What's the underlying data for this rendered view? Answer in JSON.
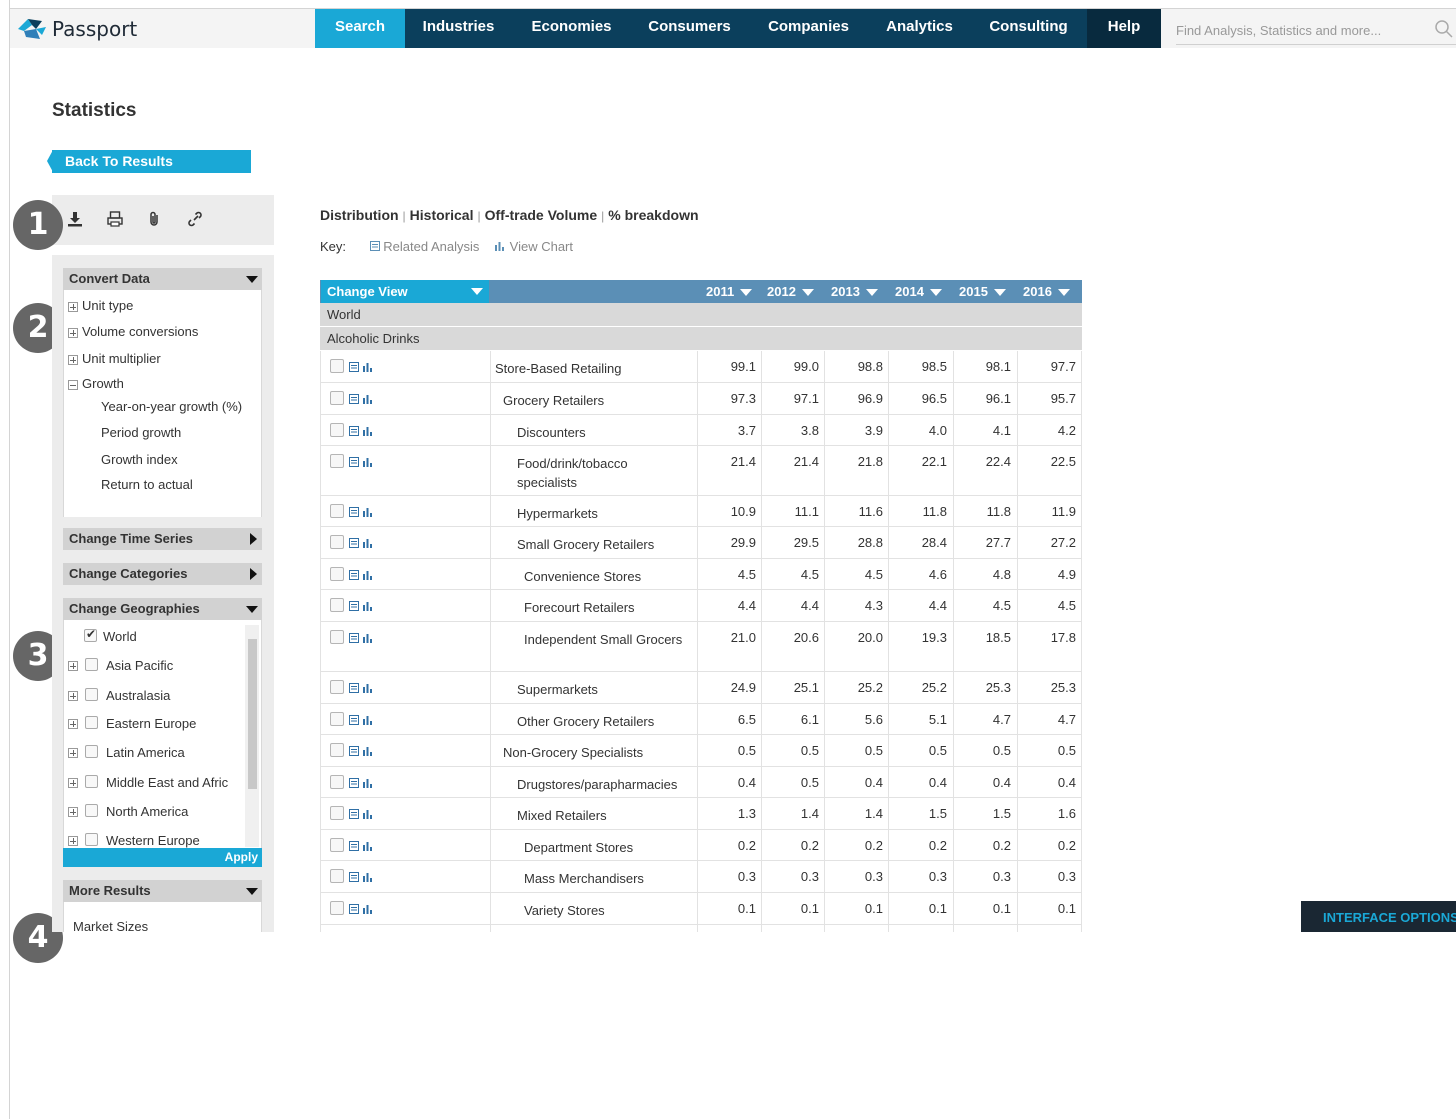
{
  "app": {
    "name": "Passport"
  },
  "nav": {
    "items": [
      {
        "label": "Search"
      },
      {
        "label": "Industries"
      },
      {
        "label": "Economies"
      },
      {
        "label": "Consumers"
      },
      {
        "label": "Companies"
      },
      {
        "label": "Analytics"
      },
      {
        "label": "Consulting"
      },
      {
        "label": "Help"
      }
    ],
    "active": "Search"
  },
  "search": {
    "placeholder": "Find Analysis, Statistics and more..."
  },
  "page": {
    "title": "Statistics",
    "back_label": "Back To Results"
  },
  "toolbar": {
    "icons": [
      "download-icon",
      "print-icon",
      "attach-icon",
      "link-icon"
    ]
  },
  "markers": [
    "1",
    "2",
    "3",
    "4"
  ],
  "sidebar": {
    "convert": {
      "title": "Convert Data",
      "items": [
        {
          "label": "Unit type"
        },
        {
          "label": "Volume conversions"
        },
        {
          "label": "Unit multiplier"
        },
        {
          "label": "Growth"
        }
      ],
      "growth_items": [
        {
          "label": "Year-on-year growth (%)"
        },
        {
          "label": "Period growth"
        },
        {
          "label": "Growth index"
        },
        {
          "label": "Return to actual"
        }
      ]
    },
    "time_series": {
      "title": "Change Time Series"
    },
    "categories": {
      "title": "Change Categories"
    },
    "geographies": {
      "title": "Change Geographies",
      "items": [
        {
          "label": "World",
          "checked": true
        },
        {
          "label": "Asia Pacific",
          "checked": false
        },
        {
          "label": "Australasia",
          "checked": false
        },
        {
          "label": "Eastern Europe",
          "checked": false
        },
        {
          "label": "Latin America",
          "checked": false
        },
        {
          "label": "Middle East and Afric",
          "checked": false
        },
        {
          "label": "North America",
          "checked": false
        },
        {
          "label": "Western Europe",
          "checked": false
        }
      ],
      "apply_label": "Apply"
    },
    "more": {
      "title": "More Results",
      "items": [
        {
          "label": "Market Sizes"
        }
      ]
    }
  },
  "breadcrumb": [
    "Distribution",
    "Historical",
    "Off-trade Volume",
    "% breakdown"
  ],
  "key": {
    "label": "Key:",
    "related": "Related Analysis",
    "chart": "View Chart"
  },
  "table": {
    "change_view": "Change View",
    "years": [
      "2011",
      "2012",
      "2013",
      "2014",
      "2015",
      "2016"
    ],
    "group_geo": "World",
    "group_cat": "Alcoholic Drinks",
    "rows": [
      {
        "label": "Store-Based Retailing",
        "values": [
          "99.1",
          "99.0",
          "98.8",
          "98.5",
          "98.1",
          "97.7"
        ]
      },
      {
        "label": "Grocery Retailers",
        "values": [
          "97.3",
          "97.1",
          "96.9",
          "96.5",
          "96.1",
          "95.7"
        ]
      },
      {
        "label": "Discounters",
        "values": [
          "3.7",
          "3.8",
          "3.9",
          "4.0",
          "4.1",
          "4.2"
        ]
      },
      {
        "label": "Food/drink/tobacco specialists",
        "values": [
          "21.4",
          "21.4",
          "21.8",
          "22.1",
          "22.4",
          "22.5"
        ]
      },
      {
        "label": "Hypermarkets",
        "values": [
          "10.9",
          "11.1",
          "11.6",
          "11.8",
          "11.8",
          "11.9"
        ]
      },
      {
        "label": "Small Grocery Retailers",
        "values": [
          "29.9",
          "29.5",
          "28.8",
          "28.4",
          "27.7",
          "27.2"
        ]
      },
      {
        "label": "Convenience Stores",
        "values": [
          "4.5",
          "4.5",
          "4.5",
          "4.6",
          "4.8",
          "4.9"
        ]
      },
      {
        "label": "Forecourt Retailers",
        "values": [
          "4.4",
          "4.4",
          "4.3",
          "4.4",
          "4.5",
          "4.5"
        ]
      },
      {
        "label": "Independent Small Grocers",
        "values": [
          "21.0",
          "20.6",
          "20.0",
          "19.3",
          "18.5",
          "17.8"
        ]
      },
      {
        "label": "Supermarkets",
        "values": [
          "24.9",
          "25.1",
          "25.2",
          "25.2",
          "25.3",
          "25.3"
        ]
      },
      {
        "label": "Other Grocery Retailers",
        "values": [
          "6.5",
          "6.1",
          "5.6",
          "5.1",
          "4.7",
          "4.7"
        ]
      },
      {
        "label": "Non-Grocery Specialists",
        "values": [
          "0.5",
          "0.5",
          "0.5",
          "0.5",
          "0.5",
          "0.5"
        ]
      },
      {
        "label": "Drugstores/parapharmacies",
        "values": [
          "0.4",
          "0.5",
          "0.4",
          "0.4",
          "0.4",
          "0.4"
        ]
      },
      {
        "label": "Mixed Retailers",
        "values": [
          "1.3",
          "1.4",
          "1.4",
          "1.5",
          "1.5",
          "1.6"
        ]
      },
      {
        "label": "Department Stores",
        "values": [
          "0.2",
          "0.2",
          "0.2",
          "0.2",
          "0.2",
          "0.2"
        ]
      },
      {
        "label": "Mass Merchandisers",
        "values": [
          "0.3",
          "0.3",
          "0.3",
          "0.3",
          "0.3",
          "0.3"
        ]
      },
      {
        "label": "Variety Stores",
        "values": [
          "0.1",
          "0.1",
          "0.1",
          "0.1",
          "0.1",
          "0.1"
        ]
      }
    ]
  },
  "interface_options": {
    "label": "INTERFACE OPTIONS"
  },
  "colors": {
    "nav_bg": "#0b3f5c",
    "accent": "#1aa8d6",
    "header_row": "#5b8fb6"
  }
}
